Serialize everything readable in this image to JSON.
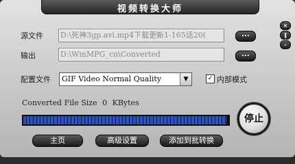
{
  "window": {
    "title": "视频转换大师"
  },
  "title_buttons": {
    "close": "×",
    "restore": "‖",
    "minimize": "–"
  },
  "source": {
    "label": "源文件",
    "value": "D:\\死神3gp.avi.mp4下载更新1-165话20(",
    "browse": "..."
  },
  "output": {
    "label": "输出",
    "value": "D:\\WinMPG_cn\\Converted",
    "browse": "..."
  },
  "config": {
    "label": "配置文件",
    "selected": "GIF Video Normal Quality",
    "arrow": "▼"
  },
  "internal_mode": {
    "label": "内部模式",
    "checked": true,
    "mark": "✓"
  },
  "file_size": {
    "label": "Converted File Size",
    "value": "0",
    "unit": "KBytes"
  },
  "progress": {
    "fraction": 0.99
  },
  "buttons": {
    "stop": "停止",
    "home": "主页",
    "advanced": "高级设置",
    "add_batch": "添加到批转换"
  },
  "colors": {
    "window_bg": "#d2d2d2",
    "button_dark": "#1a1a1a",
    "progress_blue": "#2d52b8"
  }
}
